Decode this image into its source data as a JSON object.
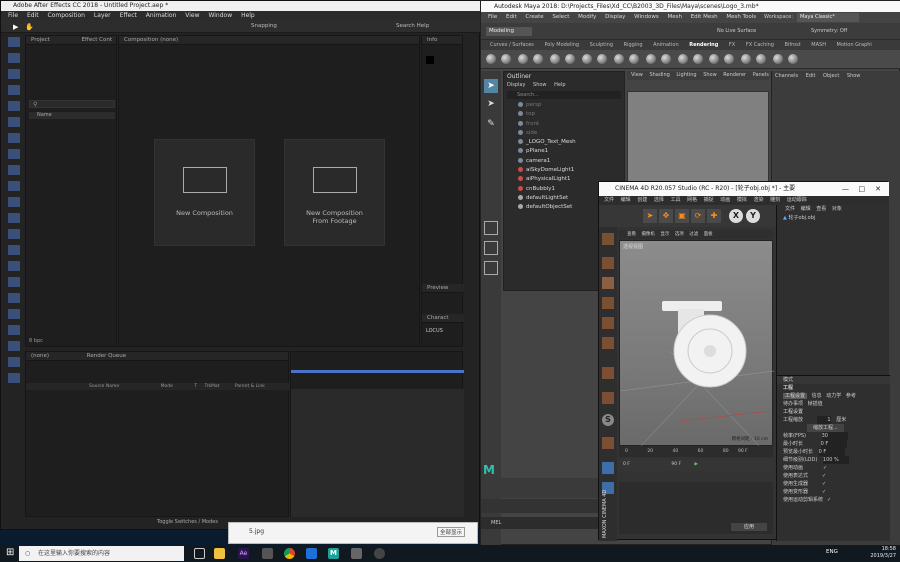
{
  "after_effects": {
    "title": "Adobe After Effects CC 2018 - Untitled Project.aep *",
    "menu": [
      "File",
      "Edit",
      "Composition",
      "Layer",
      "Effect",
      "Animation",
      "View",
      "Window",
      "Help"
    ],
    "snapping_label": "Snapping",
    "search_help_placeholder": "Search Help",
    "project_tab": "Project",
    "effect_controls_tab": "Effect Cont",
    "composition_tab": "Composition (none)",
    "info_tab": "Info",
    "name_column": "Name",
    "new_composition_label": "New Composition",
    "new_comp_from_footage_label": "New Composition From Footage",
    "preview_tab": "Preview",
    "character_tab": "Charact",
    "font_name": "LOCUS",
    "timeline_tab": "(none)",
    "render_queue_tab": "Render Queue",
    "bpc_label": "8 bpc",
    "source_name_col": "Source Name",
    "mode_col": "Mode",
    "t_col": "T",
    "trkmat_col": "TrkMat",
    "parent_col": "Parent & Link",
    "toggle_label": "Toggle Switches / Modes"
  },
  "maya": {
    "title": "Autodesk Maya 2018: D:\\Projects_Files\\Xd_CC\\B2003_3D_Files\\Maya\\scenes\\Logo_3.mb*",
    "menu": [
      "File",
      "Edit",
      "Create",
      "Select",
      "Modify",
      "Display",
      "Windows",
      "Mesh",
      "Edit Mesh",
      "Mesh Tools"
    ],
    "mode": "Modeling",
    "no_live_surface": "No Live Surface",
    "symmetry": "Symmetry: Off",
    "workspace_label": "Workspace:",
    "workspace": "Maya Classic*",
    "shelf_tabs": [
      "Curves / Surfaces",
      "Poly Modeling",
      "Sculpting",
      "Rigging",
      "Animation",
      "Rendering",
      "FX",
      "FX Caching",
      "Bifrost",
      "MASH",
      "Motion Graphi"
    ],
    "active_shelf": "Rendering",
    "outliner_title": "Outliner",
    "outliner_menu": [
      "Display",
      "Show",
      "Help"
    ],
    "search_placeholder": "Search...",
    "outliner_items": [
      {
        "label": "persp",
        "dim": true
      },
      {
        "label": "top",
        "dim": true
      },
      {
        "label": "front",
        "dim": true
      },
      {
        "label": "side",
        "dim": true
      },
      {
        "label": "_LOGO_Text_Mesh",
        "dim": false
      },
      {
        "label": "pPlane1",
        "dim": false
      },
      {
        "label": "camera1",
        "dim": false
      },
      {
        "label": "aiSkyDomeLight1",
        "dim": false
      },
      {
        "label": "aiPhysicalLight1",
        "dim": false
      },
      {
        "label": "cnBubbly1",
        "dim": false
      },
      {
        "label": "defaultLightSet",
        "dim": false
      },
      {
        "label": "defaultObjectSet",
        "dim": false
      }
    ],
    "viewport_menu": [
      "View",
      "Shading",
      "Lighting",
      "Show",
      "Renderer",
      "Panels"
    ],
    "channel_menu": [
      "Channels",
      "Edit",
      "Object",
      "Show"
    ],
    "mel_label": "MEL"
  },
  "cinema4d": {
    "title": "CINEMA 4D R20.057 Studio (RC - R20) - [轮子obj.obj *] - 主要",
    "menu": [
      "文件",
      "编辑",
      "创建",
      "选择",
      "工具",
      "网格",
      "捕捉",
      "动画",
      "模拟",
      "渲染",
      "雕刻",
      "运动跟踪"
    ],
    "viewport_menu": [
      "查看",
      "摄像机",
      "显示",
      "选项",
      "过滤",
      "面板"
    ],
    "viewport_label": "透视视图",
    "grid_spacing": "网格间距 : 10 cm",
    "object_tabs": [
      "文件",
      "编辑",
      "查看",
      "对象"
    ],
    "object_name": "轮子obj.obj",
    "attr_header": "模式",
    "attr_section": "工程",
    "attr_tabs": [
      "工程设置",
      "信息",
      "动力学",
      "参考"
    ],
    "attr_tabs2": [
      "待办事项",
      "帧插值"
    ],
    "section_label": "工程设置",
    "scale_label": "工程缩放",
    "scale_value": "1",
    "scale_unit": "厘米",
    "scale_project_btn": "缩放工程...",
    "fps_label": "帧率(FPS)",
    "fps_value": "30",
    "min_time_label": "最小时长",
    "min_time_value": "0 F",
    "preview_min_label": "预览最小时长",
    "preview_min_value": "0 F",
    "lod_label": "细节级别(LOD)",
    "lod_value": "100 %",
    "use_anim": "使用动画",
    "use_expr": "使用表达式",
    "use_gen": "使用生成器",
    "use_deform": "使用变形器",
    "use_motion": "使用运动剪辑系统",
    "timeline_ticks": [
      "0",
      "20",
      "40",
      "60",
      "80",
      "90 F"
    ],
    "frame_start": "0 F",
    "frame_end": "90 F",
    "apply_btn": "应用",
    "brand": "MAXON CINEMA 4D"
  },
  "taskbar": {
    "search_placeholder": "在这里输入你要搜索的内容",
    "time": "18:58",
    "date": "2019/3/27",
    "lang": "ENG",
    "footage_file": "5.jpg",
    "footage_btn": "全部显示"
  }
}
